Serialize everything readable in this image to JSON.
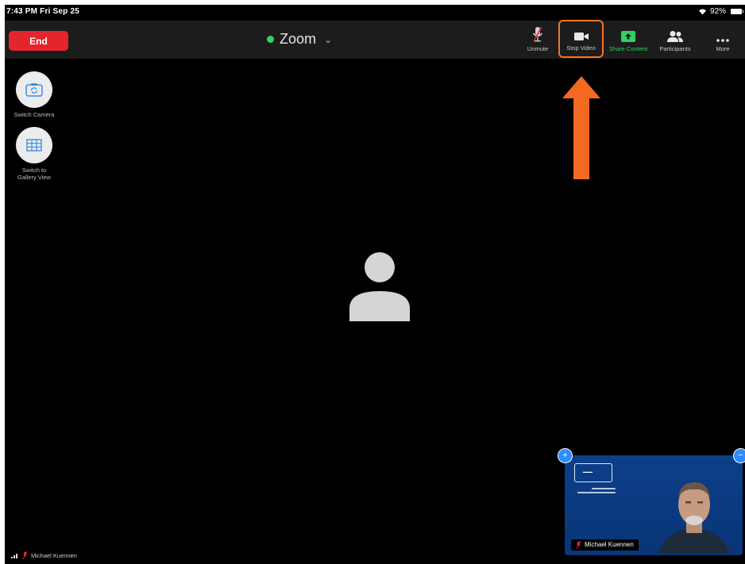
{
  "status_bar": {
    "time": "7:43 PM  Fri Sep 25",
    "battery": "92%"
  },
  "toolbar": {
    "end_label": "End",
    "meeting_title": "Zoom",
    "buttons": [
      {
        "id": "unmute",
        "label": "Unmute",
        "icon": "muted-mic-icon"
      },
      {
        "id": "stop-video",
        "label": "Stop Video",
        "icon": "video-camera-icon"
      },
      {
        "id": "share-content",
        "label": "Share Content",
        "icon": "share-screen-icon"
      },
      {
        "id": "participants",
        "label": "Participants",
        "icon": "participants-icon"
      },
      {
        "id": "more",
        "label": "More",
        "icon": "ellipsis-icon"
      }
    ]
  },
  "side_controls": {
    "switch_camera": "Switch Camera",
    "gallery_view": "Switch to Gallery View"
  },
  "self_view": {
    "name": "Michael Kuennen"
  },
  "bottom_status": {
    "name": "Michael Kuennen"
  },
  "colors": {
    "end_button": "#e5252c",
    "highlight": "#f5751f",
    "share_green": "#2fd263",
    "self_view_bg": "#0c3f8a",
    "handle_blue": "#2d8cff"
  }
}
